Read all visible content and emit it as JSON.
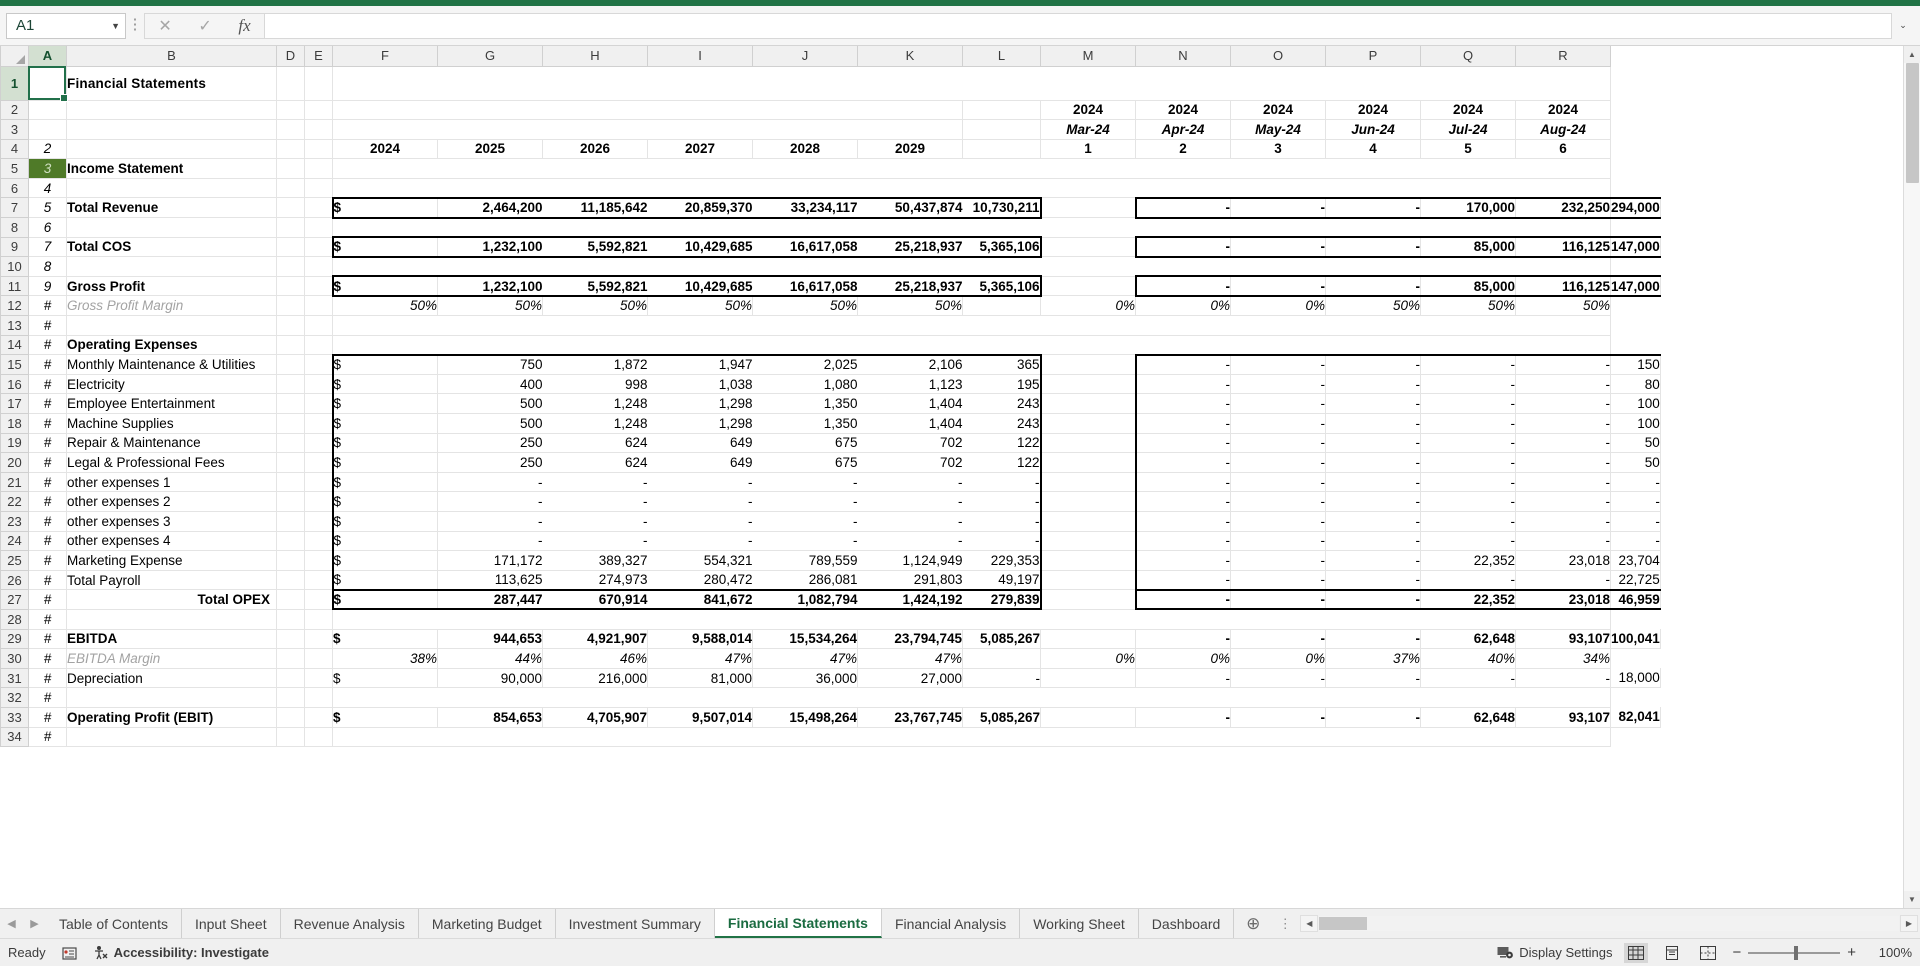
{
  "app": {
    "name_box_value": "A1",
    "formula_value": "",
    "icons": {
      "cancel": "✕",
      "confirm": "✓",
      "fx": "fx",
      "caret_down": "▼",
      "expand": "⌄"
    }
  },
  "columns": [
    "A",
    "B",
    "D",
    "E",
    "F",
    "G",
    "H",
    "I",
    "J",
    "K",
    "L",
    "M",
    "N",
    "O",
    "P",
    "Q",
    "R"
  ],
  "row_numbers": [
    1,
    2,
    3,
    4,
    5,
    6,
    7,
    8,
    9,
    10,
    11,
    12,
    13,
    14,
    15,
    16,
    17,
    18,
    19,
    20,
    21,
    22,
    23,
    24,
    25,
    26,
    27,
    28,
    29,
    30,
    31,
    32,
    33,
    34
  ],
  "sheet": {
    "title": "Financial Statements",
    "section_header": "Income Statement",
    "total_opex_label": "Total OPEX",
    "colA_index": [
      "",
      "",
      "",
      "2",
      "3",
      "4",
      "5",
      "6",
      "7",
      "8",
      "9",
      "#",
      "#",
      "#",
      "#",
      "#",
      "#",
      "#",
      "#",
      "#",
      "#",
      "#",
      "#",
      "#",
      "#",
      "#",
      "#",
      "#",
      "#",
      "#",
      "#",
      "#",
      "#",
      "#"
    ],
    "annual_years": [
      "2024",
      "2025",
      "2026",
      "2027",
      "2028",
      "2029"
    ],
    "monthly_years": [
      "2024",
      "2024",
      "2024",
      "2024",
      "2024",
      "2024"
    ],
    "monthly_dates": [
      "Mar-24",
      "Apr-24",
      "May-24",
      "Jun-24",
      "Jul-24",
      "Aug-24"
    ],
    "monthly_index": [
      "1",
      "2",
      "3",
      "4",
      "5",
      "6"
    ]
  },
  "rows": {
    "total_revenue": {
      "label": "Total Revenue",
      "annual": [
        "2,464,200",
        "11,185,642",
        "20,859,370",
        "33,234,117",
        "50,437,874",
        "10,730,211"
      ],
      "monthly": [
        "-",
        "-",
        "-",
        "170,000",
        "232,250",
        "294,000"
      ]
    },
    "total_cos": {
      "label": "Total COS",
      "annual": [
        "1,232,100",
        "5,592,821",
        "10,429,685",
        "16,617,058",
        "25,218,937",
        "5,365,106"
      ],
      "monthly": [
        "-",
        "-",
        "-",
        "85,000",
        "116,125",
        "147,000"
      ]
    },
    "gross_profit": {
      "label": "Gross Profit",
      "annual": [
        "1,232,100",
        "5,592,821",
        "10,429,685",
        "16,617,058",
        "25,218,937",
        "5,365,106"
      ],
      "monthly": [
        "-",
        "-",
        "-",
        "85,000",
        "116,125",
        "147,000"
      ]
    },
    "gross_profit_margin": {
      "label": "Gross Profit Margin",
      "annual": [
        "50%",
        "50%",
        "50%",
        "50%",
        "50%",
        "50%"
      ],
      "monthly": [
        "0%",
        "0%",
        "0%",
        "50%",
        "50%",
        "50%"
      ]
    },
    "operating_expenses_header": {
      "label": "Operating Expenses"
    },
    "opex_items": [
      {
        "label": "Monthly Maintenance & Utilities",
        "annual": [
          "750",
          "1,872",
          "1,947",
          "2,025",
          "2,106",
          "365"
        ],
        "monthly": [
          "-",
          "-",
          "-",
          "-",
          "-",
          "150"
        ]
      },
      {
        "label": "Electricity",
        "annual": [
          "400",
          "998",
          "1,038",
          "1,080",
          "1,123",
          "195"
        ],
        "monthly": [
          "-",
          "-",
          "-",
          "-",
          "-",
          "80"
        ]
      },
      {
        "label": "Employee Entertainment",
        "annual": [
          "500",
          "1,248",
          "1,298",
          "1,350",
          "1,404",
          "243"
        ],
        "monthly": [
          "-",
          "-",
          "-",
          "-",
          "-",
          "100"
        ]
      },
      {
        "label": "Machine Supplies",
        "annual": [
          "500",
          "1,248",
          "1,298",
          "1,350",
          "1,404",
          "243"
        ],
        "monthly": [
          "-",
          "-",
          "-",
          "-",
          "-",
          "100"
        ]
      },
      {
        "label": "Repair & Maintenance",
        "annual": [
          "250",
          "624",
          "649",
          "675",
          "702",
          "122"
        ],
        "monthly": [
          "-",
          "-",
          "-",
          "-",
          "-",
          "50"
        ]
      },
      {
        "label": "Legal & Professional Fees",
        "annual": [
          "250",
          "624",
          "649",
          "675",
          "702",
          "122"
        ],
        "monthly": [
          "-",
          "-",
          "-",
          "-",
          "-",
          "50"
        ]
      },
      {
        "label": "other expenses 1",
        "annual": [
          "-",
          "-",
          "-",
          "-",
          "-",
          "-"
        ],
        "monthly": [
          "-",
          "-",
          "-",
          "-",
          "-",
          "-"
        ]
      },
      {
        "label": "other expenses 2",
        "annual": [
          "-",
          "-",
          "-",
          "-",
          "-",
          "-"
        ],
        "monthly": [
          "-",
          "-",
          "-",
          "-",
          "-",
          "-"
        ]
      },
      {
        "label": "other expenses 3",
        "annual": [
          "-",
          "-",
          "-",
          "-",
          "-",
          "-"
        ],
        "monthly": [
          "-",
          "-",
          "-",
          "-",
          "-",
          "-"
        ]
      },
      {
        "label": "other expenses 4",
        "annual": [
          "-",
          "-",
          "-",
          "-",
          "-",
          "-"
        ],
        "monthly": [
          "-",
          "-",
          "-",
          "-",
          "-",
          "-"
        ]
      },
      {
        "label": "Marketing Expense",
        "annual": [
          "171,172",
          "389,327",
          "554,321",
          "789,559",
          "1,124,949",
          "229,353"
        ],
        "monthly": [
          "-",
          "-",
          "-",
          "22,352",
          "23,018",
          "23,704"
        ]
      },
      {
        "label": "Total Payroll",
        "annual": [
          "113,625",
          "274,973",
          "280,472",
          "286,081",
          "291,803",
          "49,197"
        ],
        "monthly": [
          "-",
          "-",
          "-",
          "-",
          "-",
          "22,725"
        ]
      }
    ],
    "total_opex": {
      "label": "Total OPEX",
      "annual": [
        "287,447",
        "670,914",
        "841,672",
        "1,082,794",
        "1,424,192",
        "279,839"
      ],
      "monthly": [
        "-",
        "-",
        "-",
        "22,352",
        "23,018",
        "46,959"
      ]
    },
    "ebitda": {
      "label": "EBITDA",
      "annual": [
        "944,653",
        "4,921,907",
        "9,588,014",
        "15,534,264",
        "23,794,745",
        "5,085,267"
      ],
      "monthly": [
        "-",
        "-",
        "-",
        "62,648",
        "93,107",
        "100,041"
      ]
    },
    "ebitda_margin": {
      "label": "EBITDA Margin",
      "annual": [
        "38%",
        "44%",
        "46%",
        "47%",
        "47%",
        "47%"
      ],
      "monthly": [
        "0%",
        "0%",
        "0%",
        "37%",
        "40%",
        "34%"
      ]
    },
    "depreciation": {
      "label": "Depreciation",
      "annual": [
        "90,000",
        "216,000",
        "81,000",
        "36,000",
        "27,000",
        "-"
      ],
      "monthly": [
        "-",
        "-",
        "-",
        "-",
        "-",
        "18,000"
      ]
    },
    "operating_profit": {
      "label": "Operating Profit (EBIT)",
      "annual": [
        "854,653",
        "4,705,907",
        "9,507,014",
        "15,498,264",
        "23,767,745",
        "5,085,267"
      ],
      "monthly": [
        "-",
        "-",
        "-",
        "62,648",
        "93,107",
        "82,041"
      ]
    }
  },
  "currency_symbol": "$",
  "tabs": {
    "items": [
      {
        "label": "Table of Contents",
        "active": false
      },
      {
        "label": "Input Sheet",
        "active": false
      },
      {
        "label": "Revenue Analysis",
        "active": false
      },
      {
        "label": "Marketing Budget",
        "active": false
      },
      {
        "label": "Investment Summary",
        "active": false
      },
      {
        "label": "Financial Statements",
        "active": true
      },
      {
        "label": "Financial Analysis",
        "active": false
      },
      {
        "label": "Working Sheet",
        "active": false
      },
      {
        "label": "Dashboard",
        "active": false
      }
    ],
    "add_label": "⊕",
    "dots_label": "⋮",
    "prev_label": "◀",
    "next_label": "▶"
  },
  "status": {
    "ready": "Ready",
    "accessibility": "Accessibility: Investigate",
    "display_settings": "Display Settings",
    "zoom": "100%",
    "zoom_out": "−",
    "zoom_in": "+"
  },
  "colors": {
    "brand_green": "#217346",
    "banner_green": "#4f7a28",
    "header_gray": "#f0f0f0"
  }
}
